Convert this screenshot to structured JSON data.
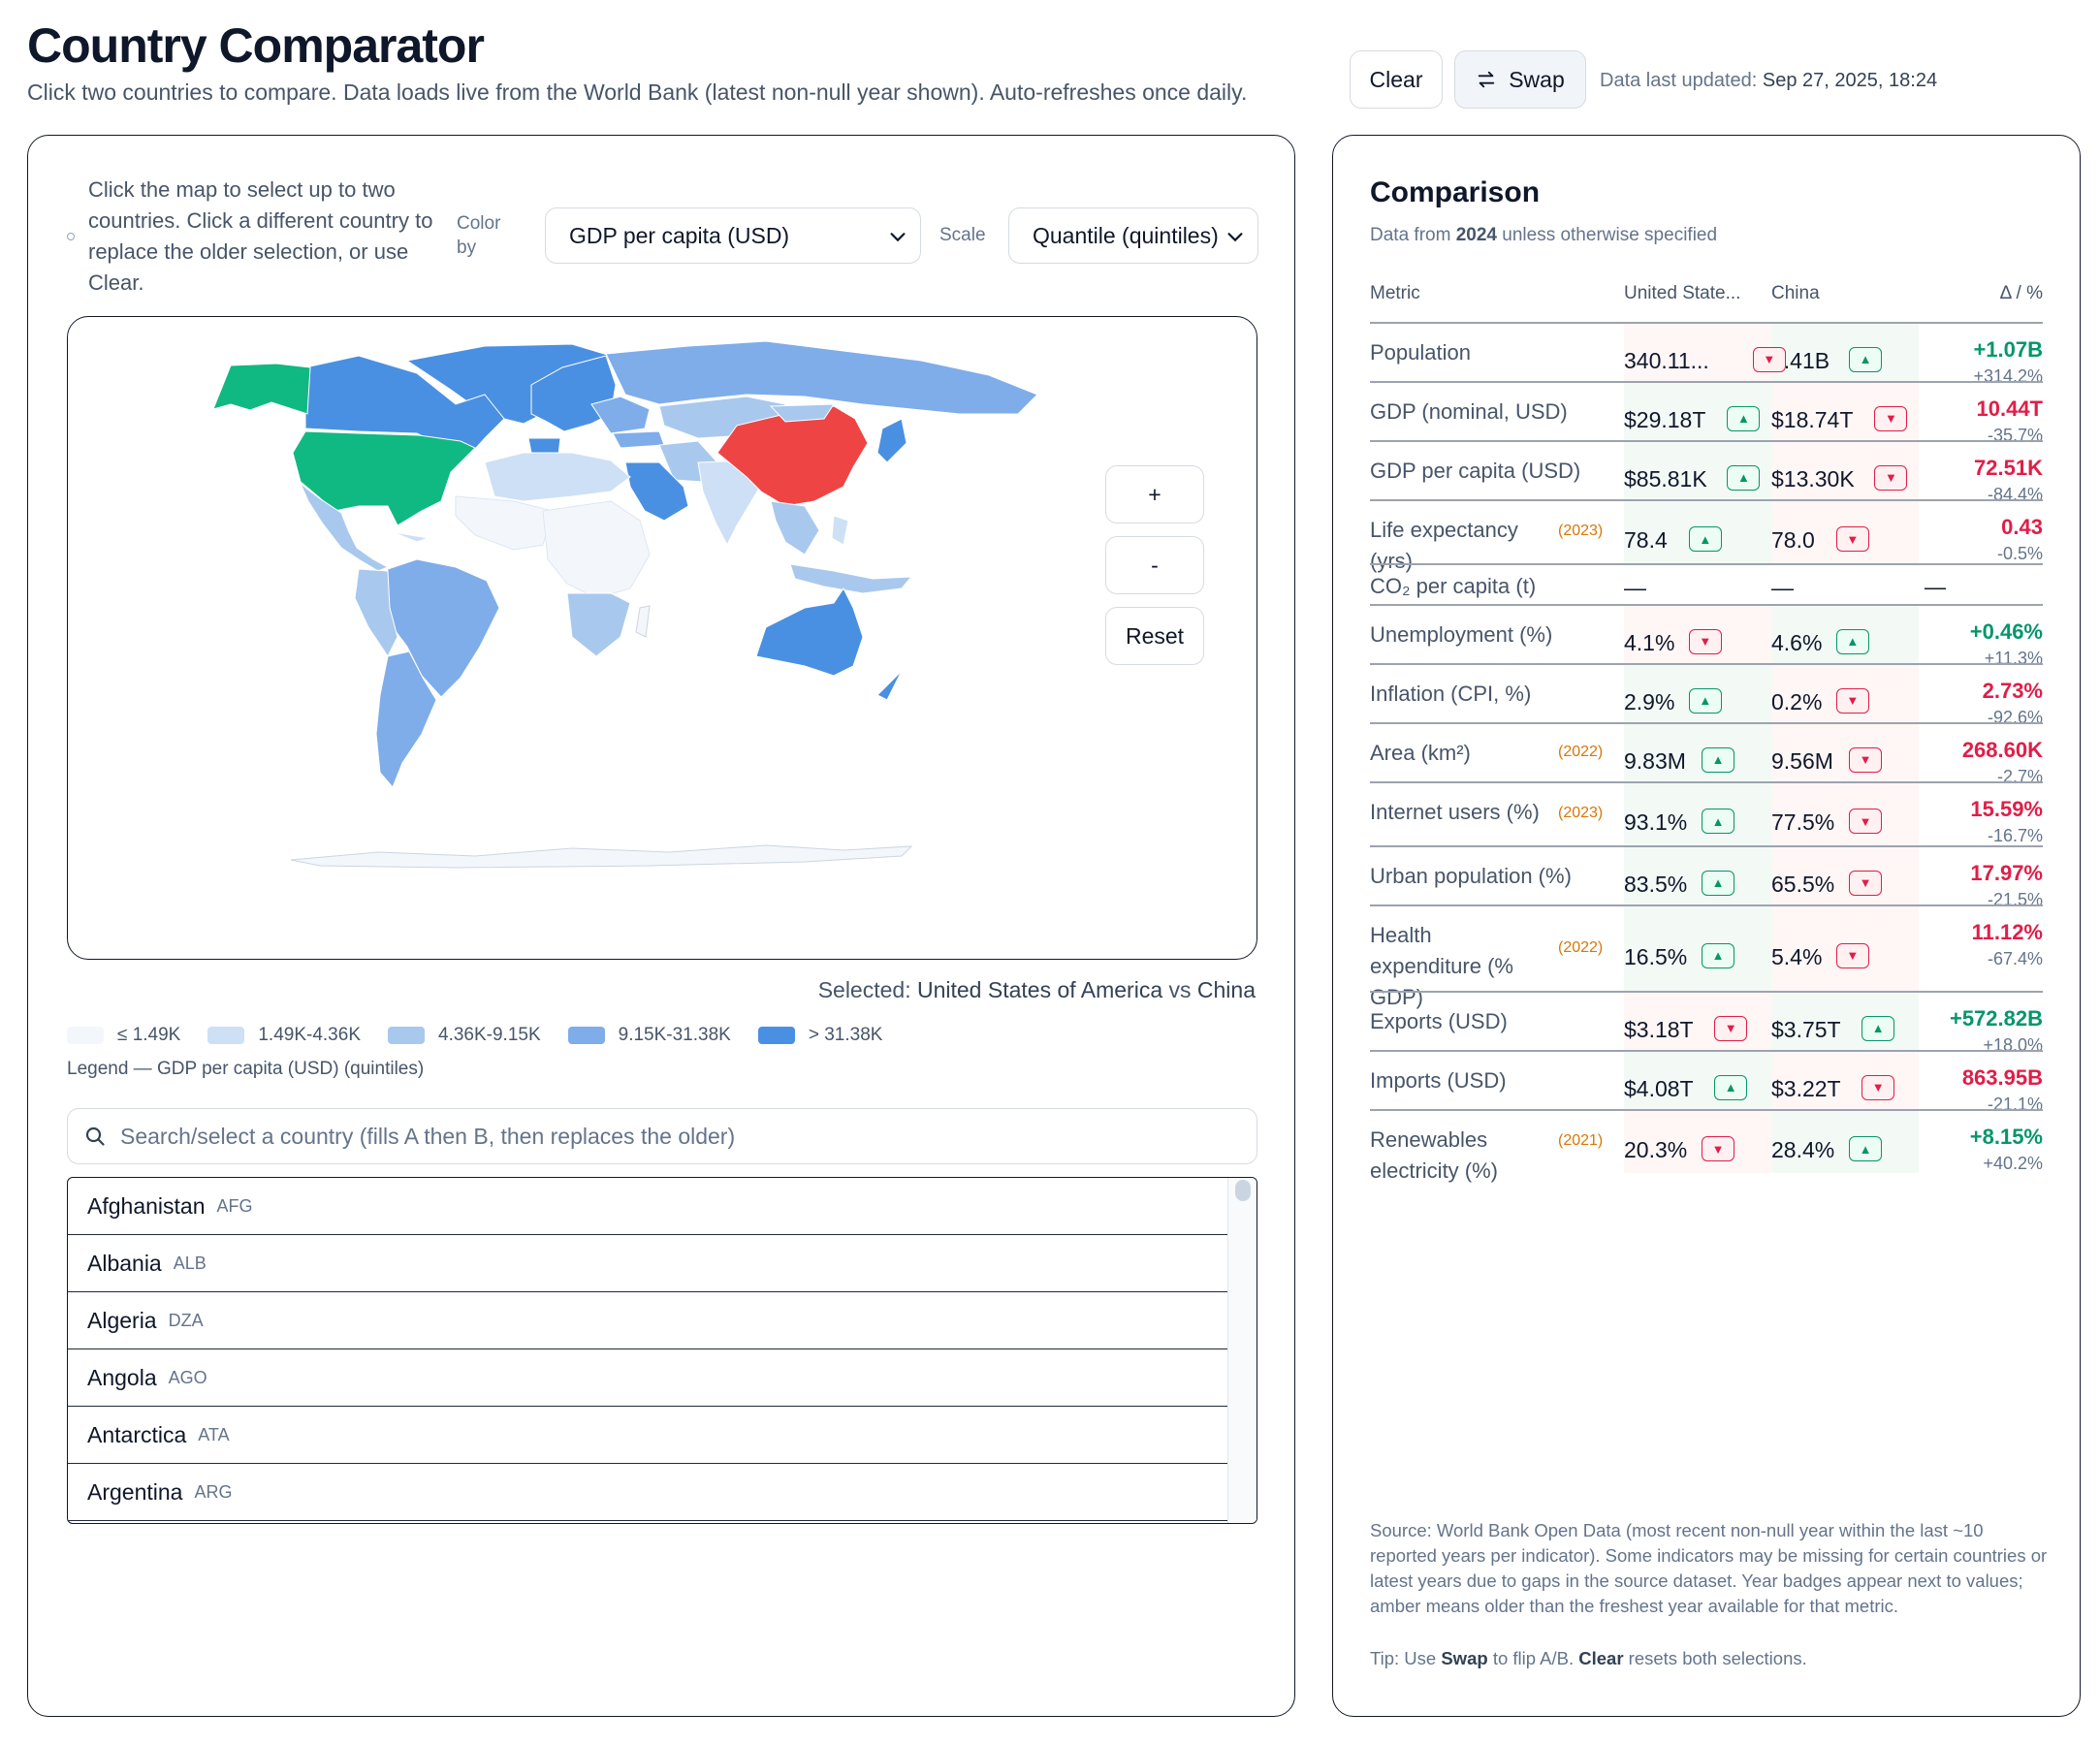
{
  "header": {
    "title": "Country Comparator",
    "subtitle": "Click two countries to compare. Data loads live from the World Bank (latest non-null year shown). Auto-refreshes once daily.",
    "clear_label": "Clear",
    "swap_label": "Swap",
    "updated_label": "Data last updated:",
    "updated_value": "Sep 27, 2025, 18:24"
  },
  "map_panel": {
    "instructions": "Click the map to select up to two countries. Click a different country to replace the older selection, or use Clear.",
    "color_by_label": "Color by",
    "metric_value": "GDP per capita (USD)",
    "scale_label": "Scale",
    "scale_value": "Quantile (quintiles)",
    "zoom_in": "+",
    "zoom_out": "-",
    "reset": "Reset",
    "selected_label": "Selected:",
    "selected_a": "United States of America",
    "vs": "vs",
    "selected_b": "China",
    "legend": [
      {
        "label": "≤ 1.49K",
        "color": "#f3f7fc"
      },
      {
        "label": "1.49K-4.36K",
        "color": "#cde0f5"
      },
      {
        "label": "4.36K-9.15K",
        "color": "#a9c8ee"
      },
      {
        "label": "9.15K-31.38K",
        "color": "#7eadea"
      },
      {
        "label": "> 31.38K",
        "color": "#4a90e2"
      }
    ],
    "legend_caption": "Legend — GDP per capita (USD) (quintiles)",
    "selection_colors": {
      "a": "#10b981",
      "b": "#ef4444"
    },
    "search_placeholder": "Search/select a country (fills A then B, then replaces the older)",
    "countries": [
      {
        "name": "Afghanistan",
        "iso": "AFG"
      },
      {
        "name": "Albania",
        "iso": "ALB"
      },
      {
        "name": "Algeria",
        "iso": "DZA"
      },
      {
        "name": "Angola",
        "iso": "AGO"
      },
      {
        "name": "Antarctica",
        "iso": "ATA"
      },
      {
        "name": "Argentina",
        "iso": "ARG"
      }
    ]
  },
  "comparison": {
    "title": "Comparison",
    "sub_prefix": "Data from",
    "sub_year": "2024",
    "sub_suffix": "unless otherwise specified",
    "col_metric": "Metric",
    "col_a": "United State...",
    "col_b": "China",
    "col_delta": "Δ / %",
    "rows": [
      {
        "metric": "Population",
        "year": "",
        "a": "340.11...",
        "a_dir": "down",
        "b": "1.41B",
        "b_dir": "up",
        "delta": "+1.07B",
        "pct": "+314.2%",
        "sign": "pos"
      },
      {
        "metric": "GDP (nominal, USD)",
        "year": "",
        "a": "$29.18T",
        "a_dir": "up",
        "b": "$18.74T",
        "b_dir": "down",
        "delta": "10.44T",
        "pct": "-35.7%",
        "sign": "neg"
      },
      {
        "metric": "GDP per capita (USD)",
        "year": "",
        "a": "$85.81K",
        "a_dir": "up",
        "b": "$13.30K",
        "b_dir": "down",
        "delta": "72.51K",
        "pct": "-84.4%",
        "sign": "neg"
      },
      {
        "metric": "Life expectancy (yrs)",
        "year": "(2023)",
        "a": "78.4",
        "a_dir": "up",
        "b": "78.0",
        "b_dir": "down",
        "delta": "0.43",
        "pct": "-0.5%",
        "sign": "neg"
      },
      {
        "metric": "CO₂ per capita (t)",
        "year": "",
        "a": "—",
        "a_dir": "",
        "b": "—",
        "b_dir": "",
        "delta": "—",
        "pct": "",
        "sign": "none"
      },
      {
        "metric": "Unemployment (%)",
        "year": "",
        "a": "4.1%",
        "a_dir": "down",
        "b": "4.6%",
        "b_dir": "up",
        "delta": "+0.46%",
        "pct": "+11.3%",
        "sign": "pos"
      },
      {
        "metric": "Inflation (CPI, %)",
        "year": "",
        "a": "2.9%",
        "a_dir": "up",
        "b": "0.2%",
        "b_dir": "down",
        "delta": "2.73%",
        "pct": "-92.6%",
        "sign": "neg"
      },
      {
        "metric": "Area (km²)",
        "year": "(2022)",
        "a": "9.83M",
        "a_dir": "up",
        "b": "9.56M",
        "b_dir": "down",
        "delta": "268.60K",
        "pct": "-2.7%",
        "sign": "neg"
      },
      {
        "metric": "Internet users (%)",
        "year": "(2023)",
        "a": "93.1%",
        "a_dir": "up",
        "b": "77.5%",
        "b_dir": "down",
        "delta": "15.59%",
        "pct": "-16.7%",
        "sign": "neg"
      },
      {
        "metric": "Urban population (%)",
        "year": "",
        "a": "83.5%",
        "a_dir": "up",
        "b": "65.5%",
        "b_dir": "down",
        "delta": "17.97%",
        "pct": "-21.5%",
        "sign": "neg"
      },
      {
        "metric": "Health expenditure (% GDP)",
        "year": "(2022)",
        "a": "16.5%",
        "a_dir": "up",
        "b": "5.4%",
        "b_dir": "down",
        "delta": "11.12%",
        "pct": "-67.4%",
        "sign": "neg"
      },
      {
        "metric": "Exports (USD)",
        "year": "",
        "a": "$3.18T",
        "a_dir": "down",
        "b": "$3.75T",
        "b_dir": "up",
        "delta": "+572.82B",
        "pct": "+18.0%",
        "sign": "pos"
      },
      {
        "metric": "Imports (USD)",
        "year": "",
        "a": "$4.08T",
        "a_dir": "up",
        "b": "$3.22T",
        "b_dir": "down",
        "delta": "863.95B",
        "pct": "-21.1%",
        "sign": "neg"
      },
      {
        "metric": "Renewables electricity (%)",
        "year": "(2021)",
        "a": "20.3%",
        "a_dir": "down",
        "b": "28.4%",
        "b_dir": "up",
        "delta": "+8.15%",
        "pct": "+40.2%",
        "sign": "pos"
      }
    ],
    "source": "Source: World Bank Open Data (most recent non-null year within the last ~10 reported years per indicator). Some indicators may be missing for certain countries or latest years due to gaps in the source dataset. Year badges appear next to values; amber means older than the freshest year available for that metric.",
    "tip_prefix": "Tip: Use",
    "tip_swap": "Swap",
    "tip_middle": "to flip A/B.",
    "tip_clear": "Clear",
    "tip_suffix": "resets both selections."
  }
}
